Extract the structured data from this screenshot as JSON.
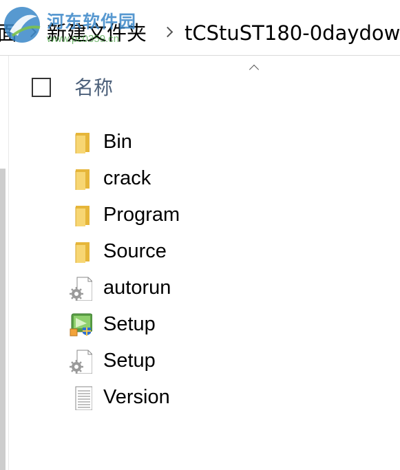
{
  "breadcrumb": {
    "items": [
      {
        "label": "面"
      },
      {
        "label": "新建文件夹"
      },
      {
        "label": "tCStuST180-0daydow"
      }
    ]
  },
  "watermark": {
    "site_name": "河东软件园",
    "url": "www.pc0359.cn"
  },
  "column_header": {
    "name_label": "名称"
  },
  "files": [
    {
      "name": "Bin",
      "icon": "folder-icon"
    },
    {
      "name": "crack",
      "icon": "folder-icon"
    },
    {
      "name": "Program",
      "icon": "folder-icon"
    },
    {
      "name": "Source",
      "icon": "folder-icon"
    },
    {
      "name": "autorun",
      "icon": "settings-file-icon"
    },
    {
      "name": "Setup",
      "icon": "installer-icon"
    },
    {
      "name": "Setup",
      "icon": "settings-file-icon"
    },
    {
      "name": "Version",
      "icon": "text-file-icon"
    }
  ],
  "colors": {
    "folder": "#f2c94c",
    "folder_dark": "#e6b63a",
    "header_text": "#4c607a",
    "watermark_blue": "#3a87c8",
    "watermark_green": "#3f9c3a"
  }
}
